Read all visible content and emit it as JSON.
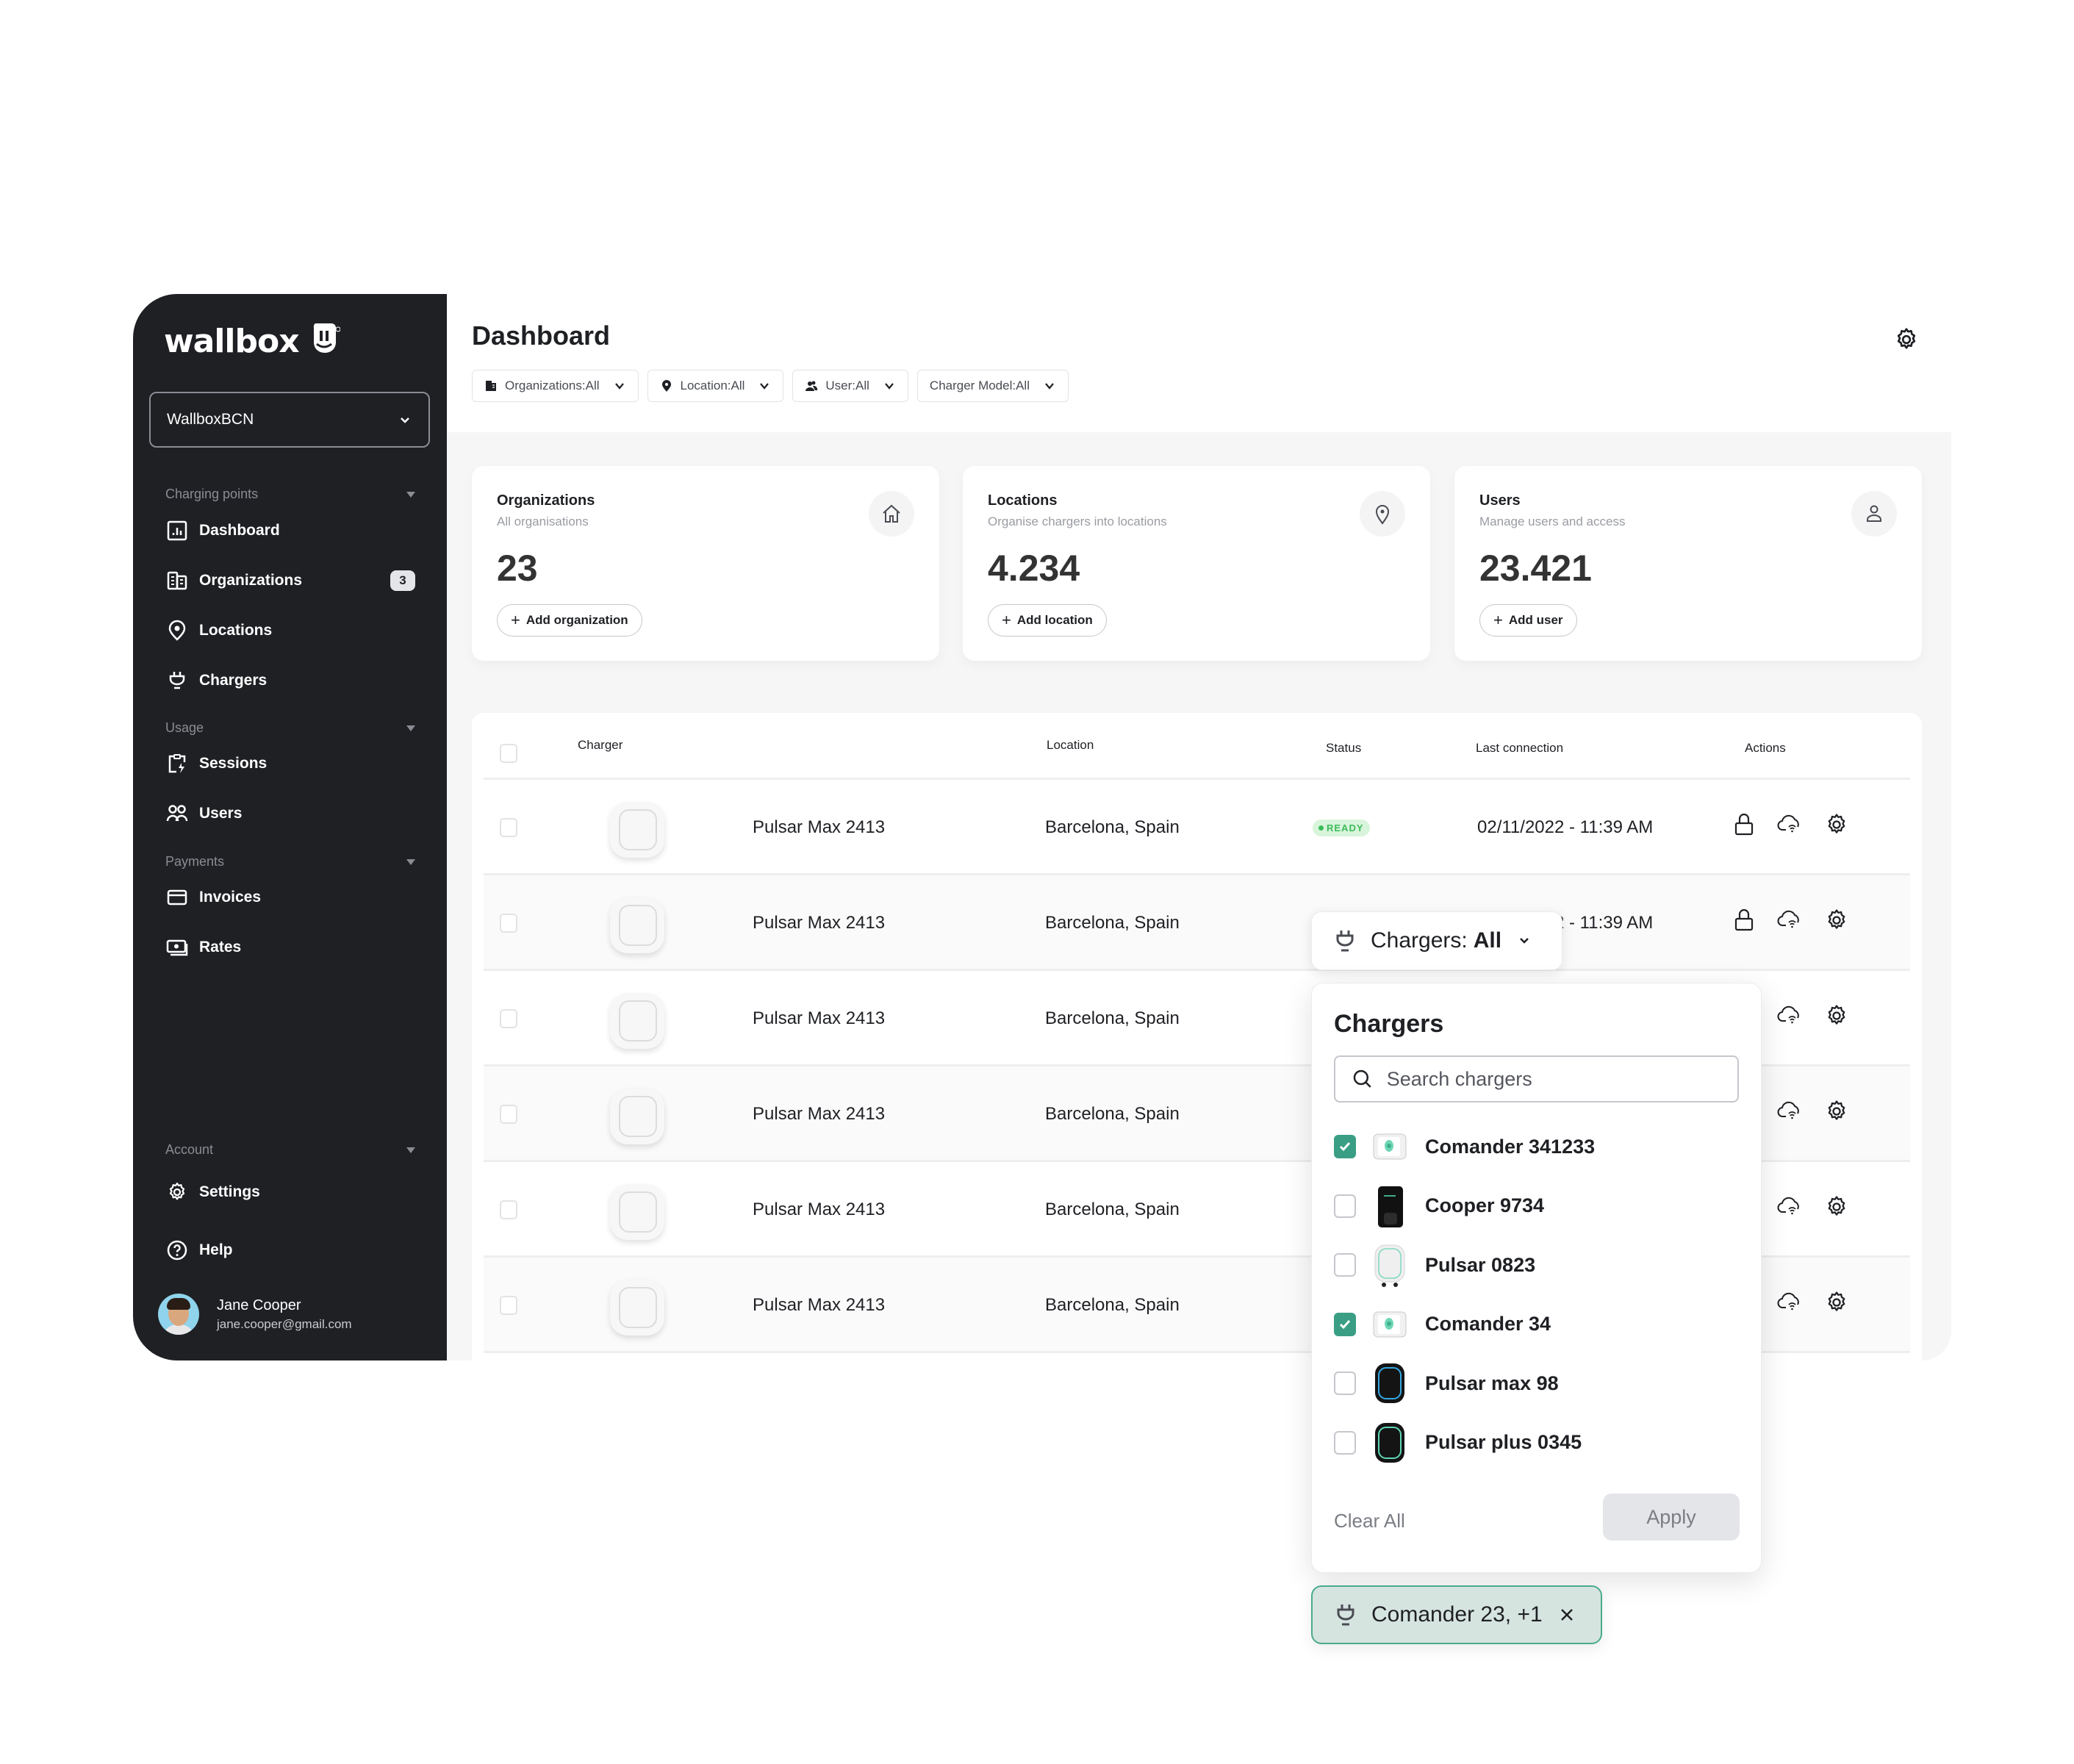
{
  "brand": {
    "name": "wallbox",
    "accent": "#3a9e84",
    "sidebar_bg": "#1f2024"
  },
  "sidebar": {
    "org_select": {
      "value": "WallboxBCN"
    },
    "sections": [
      {
        "label": "Charging points",
        "items": [
          {
            "label": "Dashboard",
            "icon": "bar-chart-icon"
          },
          {
            "label": "Organizations",
            "icon": "building-icon",
            "badge": "3"
          },
          {
            "label": "Locations",
            "icon": "location-pin-icon"
          },
          {
            "label": "Chargers",
            "icon": "plug-icon"
          }
        ]
      },
      {
        "label": "Usage",
        "items": [
          {
            "label": "Sessions",
            "icon": "clipboard-bolt-icon"
          },
          {
            "label": "Users",
            "icon": "users-icon"
          }
        ]
      },
      {
        "label": "Payments",
        "items": [
          {
            "label": "Invoices",
            "icon": "credit-card-icon"
          },
          {
            "label": "Rates",
            "icon": "banknote-icon"
          }
        ]
      },
      {
        "label": "Account",
        "items": [
          {
            "label": "Settings",
            "icon": "gear-icon"
          },
          {
            "label": "Help",
            "icon": "help-circle-icon"
          }
        ]
      }
    ],
    "user": {
      "name": "Jane Cooper",
      "email": "jane.cooper@gmail.com"
    }
  },
  "header": {
    "title": "Dashboard",
    "filters": [
      {
        "label": "Organizations:All",
        "icon": "building-icon"
      },
      {
        "label": "Location:All",
        "icon": "location-pin-icon"
      },
      {
        "label": "User:All",
        "icon": "users-icon"
      },
      {
        "label": "Charger Model:All"
      }
    ]
  },
  "cards": [
    {
      "title": "Organizations",
      "subtitle": "All organisations",
      "value": "23",
      "button": "Add organization",
      "icon": "home-icon"
    },
    {
      "title": "Locations",
      "subtitle": "Organise chargers into locations",
      "value": "4.234",
      "button": "Add location",
      "icon": "location-pin-icon"
    },
    {
      "title": "Users",
      "subtitle": "Manage users and access",
      "value": "23.421",
      "button": "Add user",
      "icon": "user-icon"
    }
  ],
  "table": {
    "columns": [
      "Charger",
      "Location",
      "Status",
      "Last connection",
      "Actions"
    ],
    "rows": [
      {
        "charger": "Pulsar Max 2413",
        "location": "Barcelona, Spain",
        "status": "READY",
        "last_connection": "02/11/2022 - 11:39 AM"
      },
      {
        "charger": "Pulsar Max 2413",
        "location": "Barcelona, Spain",
        "status": "",
        "last_connection": "02/11/2022 - 11:39 AM"
      },
      {
        "charger": "Pulsar Max 2413",
        "location": "Barcelona, Spain",
        "status": "",
        "last_connection": ""
      },
      {
        "charger": "Pulsar Max 2413",
        "location": "Barcelona, Spain",
        "status": "",
        "last_connection": ""
      },
      {
        "charger": "Pulsar Max 2413",
        "location": "Barcelona, Spain",
        "status": "",
        "last_connection": ""
      },
      {
        "charger": "Pulsar Max 2413",
        "location": "Barcelona, Spain",
        "status": "",
        "last_connection": ""
      }
    ]
  },
  "chargers_filter": {
    "trigger_prefix": "Chargers:",
    "trigger_value": "All",
    "title": "Chargers",
    "search_placeholder": "Search chargers",
    "options": [
      {
        "label": "Comander 341233",
        "checked": true,
        "model": "commander"
      },
      {
        "label": "Cooper 9734",
        "checked": false,
        "model": "copper"
      },
      {
        "label": "Pulsar 0823",
        "checked": false,
        "model": "pulsar-white"
      },
      {
        "label": "Comander 34",
        "checked": true,
        "model": "commander"
      },
      {
        "label": "Pulsar max 98",
        "checked": false,
        "model": "pulsar-max"
      },
      {
        "label": "Pulsar plus 0345",
        "checked": false,
        "model": "pulsar-plus"
      }
    ],
    "clear_label": "Clear All",
    "apply_label": "Apply",
    "selected_chip": "Comander 23, +1"
  }
}
